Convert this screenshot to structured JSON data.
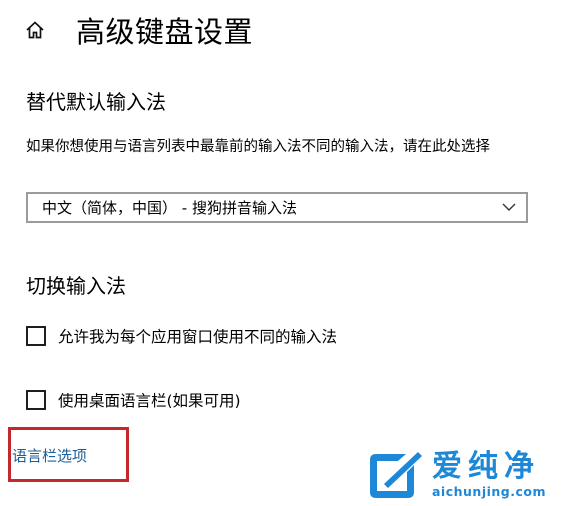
{
  "header": {
    "title": "高级键盘设置"
  },
  "override": {
    "heading": "替代默认输入法",
    "description": "如果你想使用与语言列表中最靠前的输入法不同的输入法，请在此处选择",
    "selected_value": "中文（简体，中国） - 搜狗拼音输入法"
  },
  "switching": {
    "heading": "切换输入法",
    "per_app_label": "允许我为每个应用窗口使用不同的输入法",
    "per_app_checked": false,
    "desktop_bar_label": "使用桌面语言栏(如果可用)",
    "desktop_bar_checked": false,
    "language_bar_link": "语言栏选项"
  },
  "watermark": {
    "name": "爱纯净",
    "url": "aichunjing.com"
  },
  "colors": {
    "link": "#1a5f9a",
    "highlight": "#c4272c",
    "watermark": "#1e88d8"
  },
  "icons": {
    "home": "home-icon",
    "dropdown": "chevron-down-icon",
    "logo": "aichunjing-logo-icon"
  }
}
